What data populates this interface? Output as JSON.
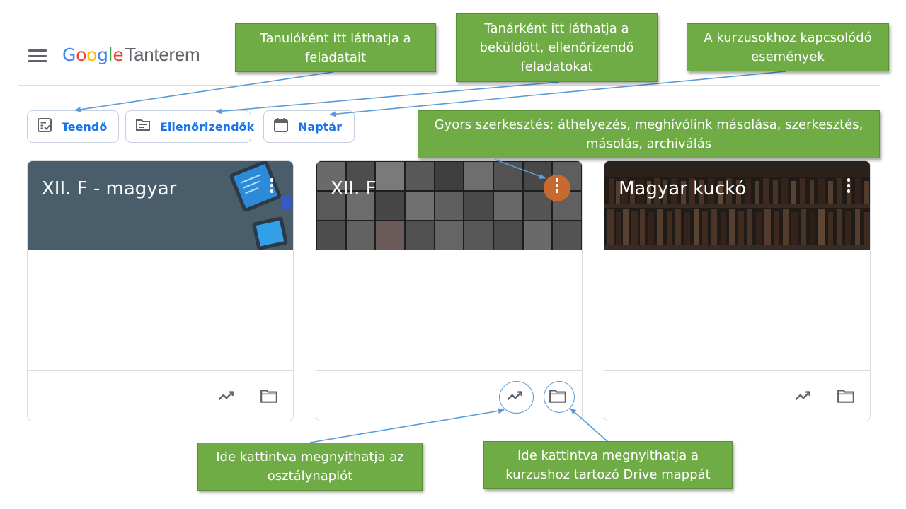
{
  "header": {
    "logo_text": "Google",
    "product_name": "Tanterem",
    "logo_letters": [
      {
        "ch": "G",
        "color": "#4285f4"
      },
      {
        "ch": "o",
        "color": "#ea4335"
      },
      {
        "ch": "o",
        "color": "#fbbc05"
      },
      {
        "ch": "g",
        "color": "#4285f4"
      },
      {
        "ch": "l",
        "color": "#34a853"
      },
      {
        "ch": "e",
        "color": "#ea4335"
      }
    ]
  },
  "nav": {
    "todo_label": "Teendő",
    "review_label": "Ellenőrizendők",
    "calendar_label": "Naptár"
  },
  "classes": [
    {
      "title": "XII. F - magyar"
    },
    {
      "title": "XII. F"
    },
    {
      "title": "Magyar kuckó"
    }
  ],
  "callouts": {
    "student": "Tanulóként itt láthatja a feladatait",
    "teacher": "Tanárként itt láthatja a beküldött, ellenőrizendő feladatokat",
    "calendar": "A kurzusokhoz kapcsolódó események",
    "quick_edit": "Gyors szerkesztés:  áthelyezés, meghívólink másolása, szerkesztés,  másolás, archiválás",
    "gradebook": "Ide kattintva megnyithatja az osztálynaplót",
    "drive": "Ide kattintva megnyithatja a kurzushoz tartozó Drive mappát"
  },
  "colors": {
    "accent": "#1a73e8",
    "callout_green": "#6fac46",
    "arrow_blue": "#5b9bd5"
  }
}
